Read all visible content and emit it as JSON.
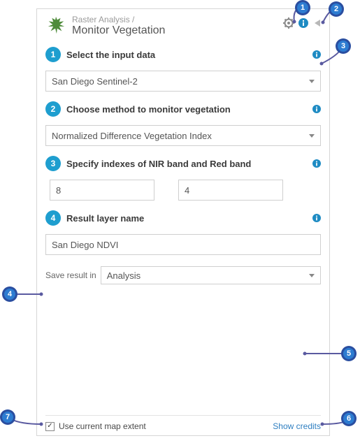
{
  "header": {
    "breadcrumb": "Raster Analysis /",
    "title": "Monitor Vegetation"
  },
  "steps": {
    "s1": {
      "num": "1",
      "label": "Select the input data",
      "value": "San Diego Sentinel-2"
    },
    "s2": {
      "num": "2",
      "label": "Choose method to monitor vegetation",
      "value": "Normalized Difference Vegetation Index"
    },
    "s3": {
      "num": "3",
      "label": "Specify indexes of NIR band and Red band",
      "nir": "8",
      "red": "4"
    },
    "s4": {
      "num": "4",
      "label": "Result layer name",
      "value": "San Diego NDVI",
      "save_label": "Save result in",
      "save_value": "Analysis"
    }
  },
  "footer": {
    "extent_label": "Use current map extent",
    "extent_checked": true,
    "credits": "Show credits"
  },
  "callouts": {
    "c1": "1",
    "c2": "2",
    "c3": "3",
    "c4": "4",
    "c5": "5",
    "c6": "6",
    "c7": "7"
  }
}
